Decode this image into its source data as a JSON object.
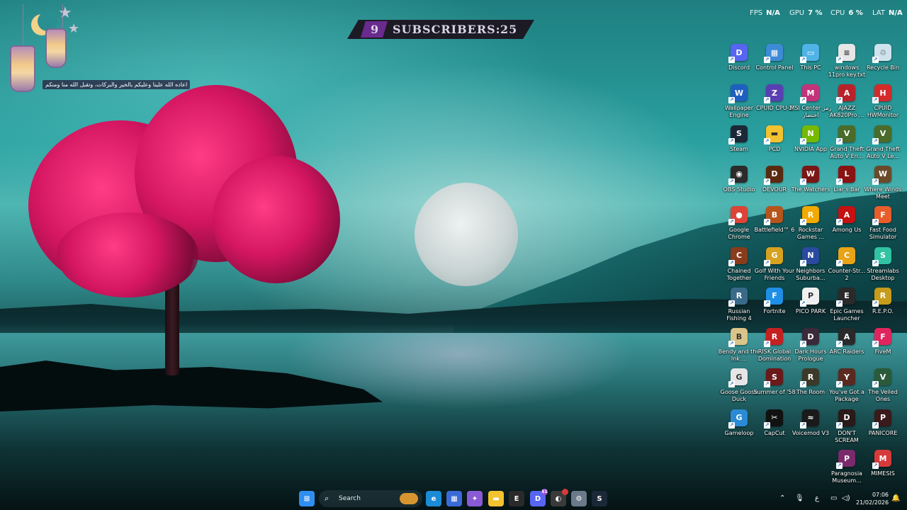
{
  "perf_overlay": {
    "fps_label": "FPS",
    "fps_value": "N/A",
    "gpu_label": "GPU",
    "gpu_value": "7 %",
    "cpu_label": "CPU",
    "cpu_value": "6 %",
    "lat_label": "LAT",
    "lat_value": "N/A"
  },
  "subscriber_banner": {
    "left_number": "9",
    "label": "SUBSCRIBERS:",
    "count": "25"
  },
  "decoration_note": "اعاده الله علينا وعليكم بالخير والبركات، وتقبل الله منا ومنكم",
  "desktop_icons": [
    {
      "label": "Discord",
      "icon": "discord-icon",
      "color": "#5865f2",
      "glyph": "D"
    },
    {
      "label": "Control Panel",
      "icon": "control-panel-icon",
      "color": "#3d8bd6",
      "glyph": "▦"
    },
    {
      "label": "This PC",
      "icon": "this-pc-icon",
      "color": "#4fb3e6",
      "glyph": "▭"
    },
    {
      "label": "windows 11pro key.txt",
      "icon": "text-file-icon",
      "color": "#e6e6e6",
      "glyph": "≡"
    },
    {
      "label": "Recycle Bin",
      "icon": "recycle-bin-icon",
      "color": "#cfe3ee",
      "glyph": "♲"
    },
    {
      "label": "Wallpaper Engine",
      "icon": "wallpaper-engine-icon",
      "color": "#1f5fbf",
      "glyph": "W"
    },
    {
      "label": "CPUID CPU-Z",
      "icon": "cpu-z-icon",
      "color": "#5a3fb3",
      "glyph": "Z"
    },
    {
      "label": "MSI Center رمز اختصار",
      "icon": "msi-center-icon",
      "color": "#c2337a",
      "glyph": "M"
    },
    {
      "label": "AJAZZ AK820Pro ...",
      "icon": "ajazz-icon",
      "color": "#b8232b",
      "glyph": "A"
    },
    {
      "label": "CPUID HWMonitor",
      "icon": "hwmonitor-icon",
      "color": "#d42a2a",
      "glyph": "H"
    },
    {
      "label": "Steam",
      "icon": "steam-icon",
      "color": "#1b2838",
      "glyph": "S"
    },
    {
      "label": "PCD",
      "icon": "folder-icon",
      "color": "#f3c22f",
      "glyph": "▬"
    },
    {
      "label": "NVIDIA App",
      "icon": "nvidia-icon",
      "color": "#76b900",
      "glyph": "N"
    },
    {
      "label": "Grand Theft Auto V En...",
      "icon": "gta-v-icon",
      "color": "#4a6b2a",
      "glyph": "V"
    },
    {
      "label": "Grand Theft Auto V Le...",
      "icon": "gta-v-legacy-icon",
      "color": "#4a6b2a",
      "glyph": "V"
    },
    {
      "label": "OBS Studio",
      "icon": "obs-icon",
      "color": "#2b2b2b",
      "glyph": "◉"
    },
    {
      "label": "DEVOUR",
      "icon": "devour-icon",
      "color": "#5a2a10",
      "glyph": "D"
    },
    {
      "label": "The Watchers",
      "icon": "the-watchers-icon",
      "color": "#7a1616",
      "glyph": "W"
    },
    {
      "label": "Liar's Bar",
      "icon": "liars-bar-icon",
      "color": "#8a1212",
      "glyph": "L"
    },
    {
      "label": "Where Winds Meet",
      "icon": "where-winds-meet-icon",
      "color": "#6b4a2a",
      "glyph": "W"
    },
    {
      "label": "Google Chrome",
      "icon": "chrome-icon",
      "color": "#db4437",
      "glyph": "●"
    },
    {
      "label": "Battlefield™ 6",
      "icon": "battlefield-icon",
      "color": "#b6541c",
      "glyph": "B"
    },
    {
      "label": "Rockstar Games ...",
      "icon": "rockstar-icon",
      "color": "#f2a900",
      "glyph": "R"
    },
    {
      "label": "Among Us",
      "icon": "among-us-icon",
      "color": "#c51111",
      "glyph": "A"
    },
    {
      "label": "Fast Food Simulator",
      "icon": "fast-food-simulator-icon",
      "color": "#e85d2a",
      "glyph": "F"
    },
    {
      "label": "Chained Together",
      "icon": "chained-together-icon",
      "color": "#8a3b1b",
      "glyph": "C"
    },
    {
      "label": "Golf With Your Friends",
      "icon": "golf-icon",
      "color": "#d6a21f",
      "glyph": "G"
    },
    {
      "label": "Neighbors Suburba...",
      "icon": "neighbors-icon",
      "color": "#2a4aa0",
      "glyph": "N"
    },
    {
      "label": "Counter-Str... 2",
      "icon": "counter-strike-icon",
      "color": "#e8a317",
      "glyph": "C"
    },
    {
      "label": "Streamlabs Desktop",
      "icon": "streamlabs-icon",
      "color": "#31c3a2",
      "glyph": "S"
    },
    {
      "label": "Russian Fishing 4",
      "icon": "russian-fishing-icon",
      "color": "#3a6a8a",
      "glyph": "R"
    },
    {
      "label": "Fortnite",
      "icon": "fortnite-icon",
      "color": "#1f8fe6",
      "glyph": "F"
    },
    {
      "label": "PICO PARK",
      "icon": "pico-park-icon",
      "color": "#f0f0f0",
      "glyph": "P"
    },
    {
      "label": "Epic Games Launcher",
      "icon": "epic-games-icon",
      "color": "#2a2a2a",
      "glyph": "E"
    },
    {
      "label": "R.E.P.O.",
      "icon": "repo-icon",
      "color": "#c79b1c",
      "glyph": "R"
    },
    {
      "label": "Bendy and the Ink ...",
      "icon": "bendy-icon",
      "color": "#d9c48a",
      "glyph": "B"
    },
    {
      "label": "RISK Global Domination",
      "icon": "risk-icon",
      "color": "#c42020",
      "glyph": "R"
    },
    {
      "label": "Dark Hours Prologue",
      "icon": "dark-hours-icon",
      "color": "#3a2a3a",
      "glyph": "D"
    },
    {
      "label": "ARC Raiders",
      "icon": "arc-raiders-icon",
      "color": "#2a2a2a",
      "glyph": "A"
    },
    {
      "label": "FiveM",
      "icon": "fivem-icon",
      "color": "#e0245e",
      "glyph": "F"
    },
    {
      "label": "Goose Goose Duck",
      "icon": "goose-goose-duck-icon",
      "color": "#e6e6e6",
      "glyph": "G"
    },
    {
      "label": "Summer of '58",
      "icon": "summer-of-58-icon",
      "color": "#6a1a1a",
      "glyph": "S"
    },
    {
      "label": "The Room",
      "icon": "the-room-icon",
      "color": "#3b3a2a",
      "glyph": "R"
    },
    {
      "label": "You've Got a Package",
      "icon": "youve-got-a-package-icon",
      "color": "#5a2a20",
      "glyph": "Y"
    },
    {
      "label": "The Veiled Ones",
      "icon": "the-veiled-ones-icon",
      "color": "#2a5a3a",
      "glyph": "V"
    },
    {
      "label": "Gameloop",
      "icon": "gameloop-icon",
      "color": "#2a8ad6",
      "glyph": "G"
    },
    {
      "label": "CapCut",
      "icon": "capcut-icon",
      "color": "#111111",
      "glyph": "✂"
    },
    {
      "label": "Voicemod V3",
      "icon": "voicemod-icon",
      "color": "#1a1a1a",
      "glyph": "≈"
    },
    {
      "label": "DON'T SCREAM",
      "icon": "dont-scream-icon",
      "color": "#2a1a1a",
      "glyph": "D"
    },
    {
      "label": "PANICORE",
      "icon": "panicore-icon",
      "color": "#3a1a1a",
      "glyph": "P"
    },
    {
      "label": "Paragnosia Museum...",
      "icon": "paragnosia-icon",
      "color": "#7a2a6a",
      "glyph": "P"
    },
    {
      "label": "MIMESIS",
      "icon": "mimesis-icon",
      "color": "#d63a3a",
      "glyph": "M"
    }
  ],
  "taskbar": {
    "search_placeholder": "Search",
    "apps": [
      {
        "name": "start-button",
        "icon": "windows-start-icon",
        "color": "#2f8ef0",
        "glyph": "⊞"
      },
      {
        "name": "taskbar-edge",
        "icon": "edge-icon",
        "color": "#1c8bd6",
        "glyph": "e"
      },
      {
        "name": "taskbar-store",
        "icon": "microsoft-store-icon",
        "color": "#3a6ad6",
        "glyph": "▦"
      },
      {
        "name": "taskbar-copilot",
        "icon": "copilot-icon",
        "color": "#8a5ad6",
        "glyph": "✦"
      },
      {
        "name": "taskbar-file-explorer",
        "icon": "file-explorer-icon",
        "color": "#f3c22f",
        "glyph": "▬"
      },
      {
        "name": "taskbar-epic-games",
        "icon": "epic-games-icon",
        "color": "#2a2a2a",
        "glyph": "E"
      },
      {
        "name": "taskbar-discord",
        "icon": "discord-icon",
        "color": "#5865f2",
        "glyph": "D"
      },
      {
        "name": "taskbar-app-badged",
        "icon": "app-icon",
        "color": "#3a3a3a",
        "glyph": "◐"
      },
      {
        "name": "taskbar-settings",
        "icon": "settings-icon",
        "color": "#6a7a8a",
        "glyph": "⚙"
      },
      {
        "name": "taskbar-steam",
        "icon": "steam-icon",
        "color": "#1b2838",
        "glyph": "S"
      }
    ],
    "discord_badge": "51",
    "tray_language": "ع",
    "clock_time": "07:06",
    "clock_date": "21/02/2026"
  }
}
